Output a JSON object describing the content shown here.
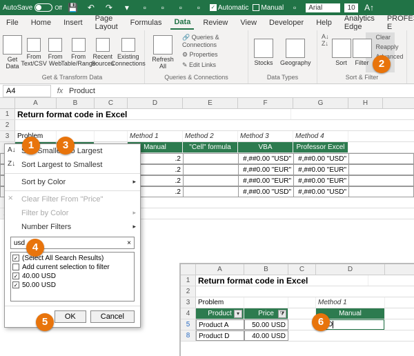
{
  "titlebar": {
    "autosave": "AutoSave",
    "autosave_state": "Off",
    "automatic": "Automatic",
    "manual": "Manual",
    "font_name": "Arial",
    "font_size": "10"
  },
  "tabs": [
    "File",
    "Home",
    "Insert",
    "Page Layout",
    "Formulas",
    "Data",
    "Review",
    "View",
    "Developer",
    "Help",
    "Analytics Edge",
    "PROFESSOR E"
  ],
  "active_tab": "Data",
  "ribbon": {
    "g1": {
      "label": "Get & Transform Data",
      "items": [
        "Get Data",
        "From Text/CSV",
        "From Web",
        "From Table/Range",
        "Recent Sources",
        "Existing Connections"
      ]
    },
    "g2": {
      "label": "Queries & Connections",
      "refresh": "Refresh All",
      "items": [
        "Queries & Connections",
        "Properties",
        "Edit Links"
      ]
    },
    "g3": {
      "label": "Data Types",
      "items": [
        "Stocks",
        "Geography"
      ]
    },
    "g4": {
      "label": "Sort & Filter",
      "sort": "Sort",
      "filter": "Filter",
      "extra": [
        "Clear",
        "Reapply",
        "Advanced"
      ]
    }
  },
  "namebox": "A4",
  "formula": "Product",
  "columns": [
    "A",
    "B",
    "C",
    "D",
    "E",
    "F",
    "G",
    "H"
  ],
  "sheet": {
    "title": "Return format code in Excel",
    "problem": "Problem",
    "methods": [
      "Method 1",
      "Method 2",
      "Method 3",
      "Method 4"
    ],
    "method_names": [
      "Manual",
      "\"Cell\" formula",
      "VBA",
      "Professor Excel"
    ],
    "hdr_product": "Product",
    "hdr_price": "Price",
    "data_rows": [
      {
        "v": ".2",
        "f": "#,##0.00 \"USD\"",
        "g": "#,##0.00 \"USD\""
      },
      {
        "v": ".2",
        "f": "#,##0.00 \"EUR\"",
        "g": "#,##0.00 \"EUR\""
      },
      {
        "v": ".2",
        "f": "#,##0.00 \"EUR\"",
        "g": "#,##0.00 \"EUR\""
      },
      {
        "v": ".2",
        "f": "#,##0.00 \"USD\"",
        "g": "#,##0.00 \"USD\""
      }
    ]
  },
  "filter_menu": {
    "sort_asc": "Sort Smallest to Largest",
    "sort_desc": "Sort Largest to Smallest",
    "sort_color": "Sort by Color",
    "clear": "Clear Filter From \"Price\"",
    "filter_color": "Filter by Color",
    "number_filters": "Number Filters",
    "search_value": "usd",
    "items": [
      "(Select All Search Results)",
      "Add current selection to filter",
      "40.00 USD",
      "50.00 USD"
    ],
    "checks": [
      true,
      false,
      true,
      true
    ],
    "ok": "OK",
    "cancel": "Cancel"
  },
  "inset": {
    "title": "Return format code in Excel",
    "problem": "Problem",
    "method1": "Method 1",
    "hdr_product": "Product",
    "hdr_price": "Price",
    "hdr_manual": "Manual",
    "rows": [
      {
        "n": "5",
        "p": "Product A",
        "pr": "50.00 USD"
      },
      {
        "n": "8",
        "p": "Product D",
        "pr": "40.00 USD"
      }
    ],
    "cellval": "USD"
  },
  "badges": {
    "b1": "1",
    "b2": "2",
    "b3": "3",
    "b4": "4",
    "b5": "5",
    "b6": "6"
  }
}
